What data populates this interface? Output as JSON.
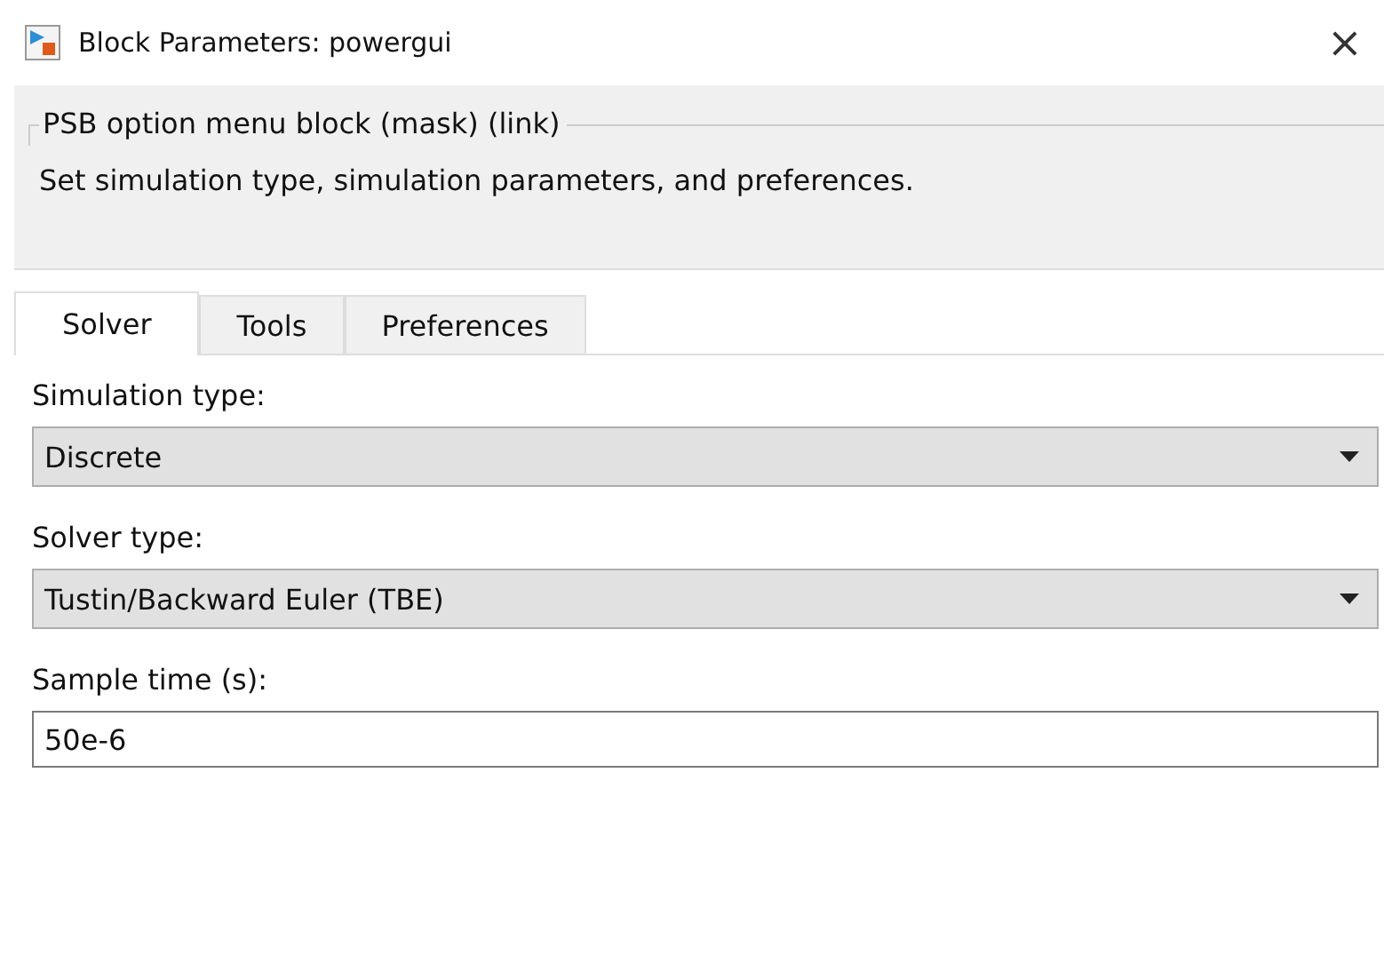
{
  "window": {
    "title": "Block Parameters: powergui",
    "close": "×"
  },
  "group": {
    "legend": "PSB option menu block (mask) (link)",
    "description": "Set simulation type, simulation parameters, and preferences."
  },
  "tabs": [
    {
      "label": "Solver",
      "selected": true
    },
    {
      "label": "Tools",
      "selected": false
    },
    {
      "label": "Preferences",
      "selected": false
    }
  ],
  "fields": [
    {
      "kind": "dropdown",
      "label": "Simulation type:",
      "value": "Discrete"
    },
    {
      "kind": "dropdown",
      "label": "Solver type:",
      "value": "Tustin/Backward Euler (TBE)"
    },
    {
      "kind": "text",
      "label": "Sample time (s):",
      "value": "50e-6"
    }
  ]
}
